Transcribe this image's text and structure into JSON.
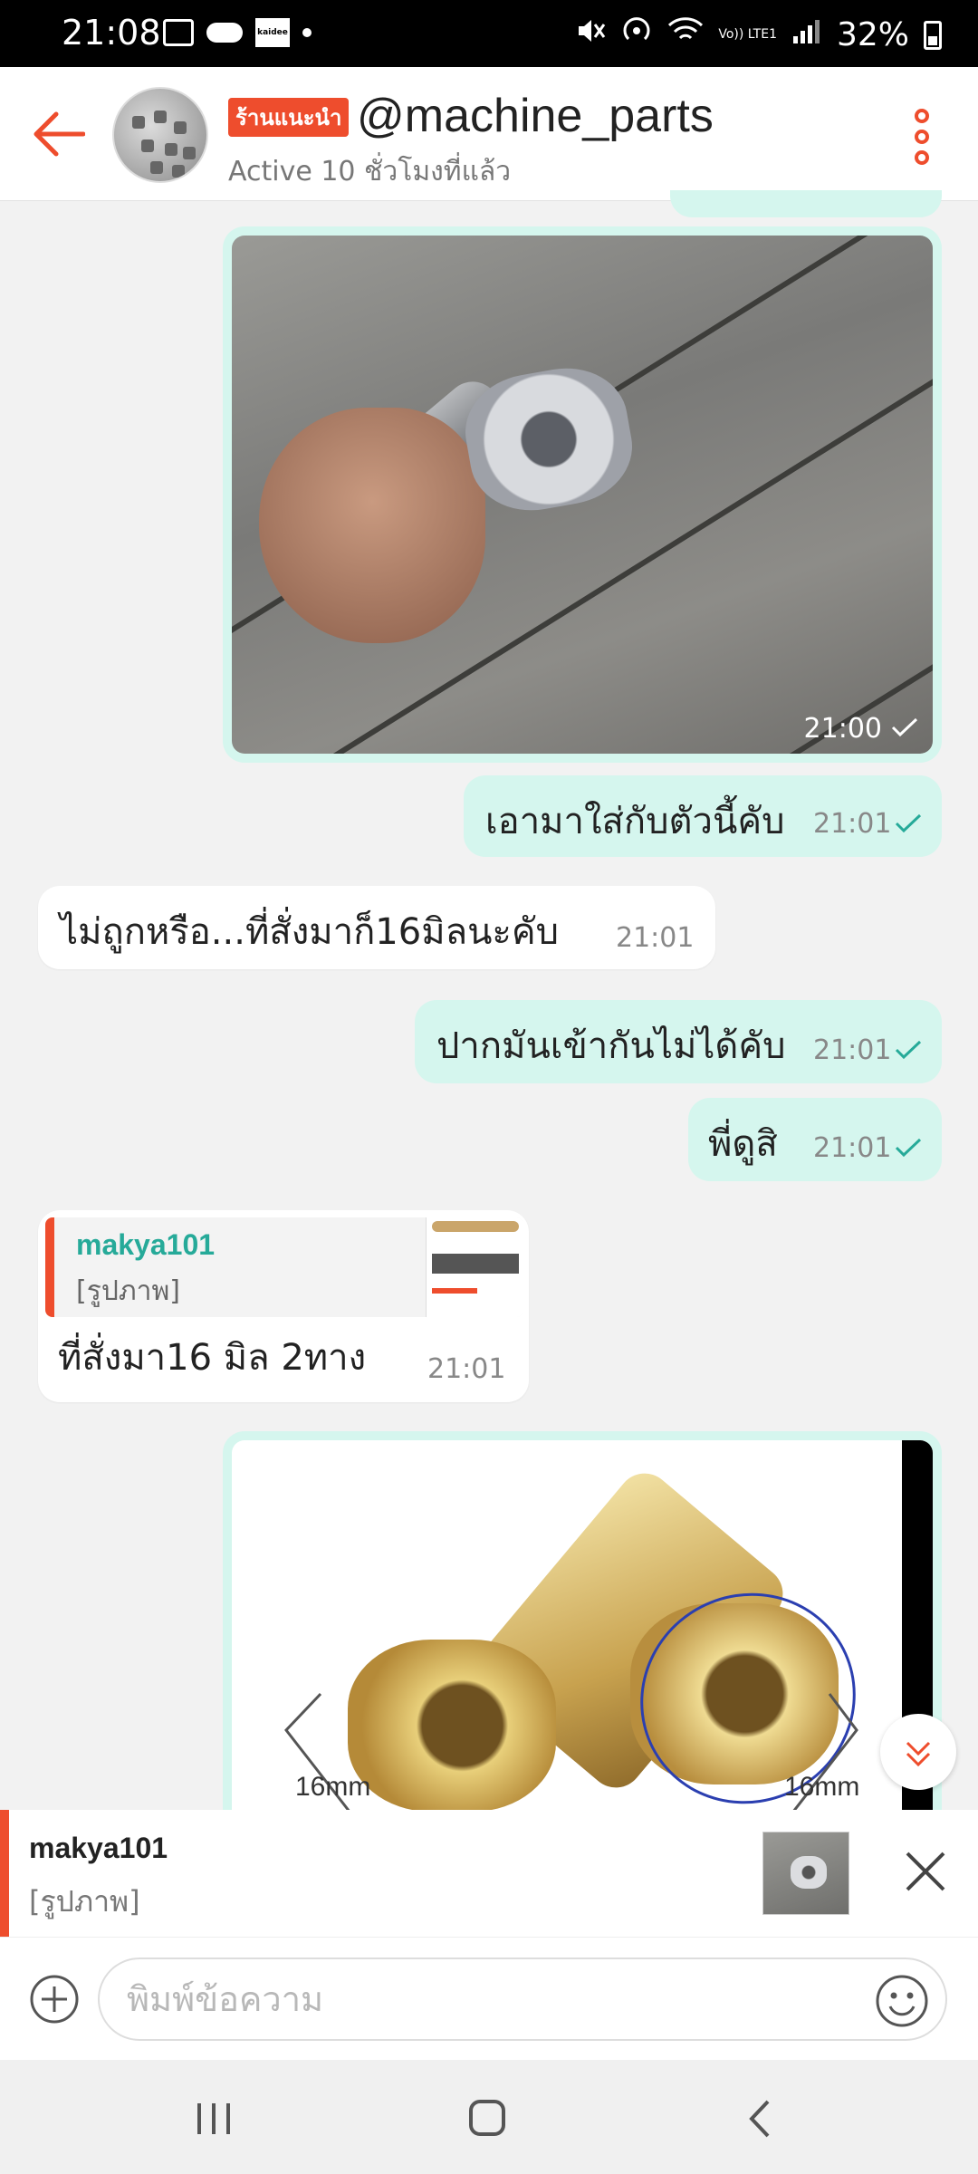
{
  "status_bar": {
    "time": "21:08",
    "kaidee": "kaidee",
    "network": "Vo)) LTE1",
    "battery": "32%"
  },
  "header": {
    "badge": "ร้านแนะนำ",
    "shop_name": "@machine_parts",
    "active": "Active 10 ชั่วโมงที่แล้ว"
  },
  "messages": [
    {
      "from": "me",
      "type": "image",
      "time": "21:00"
    },
    {
      "from": "me",
      "text": "เอามาใส่กับตัวนี้คับ",
      "time": "21:01"
    },
    {
      "from": "them",
      "text": "ไม่ถูกหรือ...ที่สั่งมาก็16มิลนะคับ",
      "time": "21:01"
    },
    {
      "from": "me",
      "text": "ปากมันเข้ากันไม่ได้คับ",
      "time": "21:01"
    },
    {
      "from": "me",
      "text": "พี่ดูสิ",
      "time": "21:01"
    },
    {
      "from": "them",
      "reply_to": {
        "name": "makya101",
        "preview": "[รูปภาพ]"
      },
      "text": "ที่สั่งมา16 มิล  2ทาง",
      "time": "21:01"
    },
    {
      "from": "me",
      "type": "image",
      "labels": [
        "16mm",
        "16mm"
      ]
    }
  ],
  "reply_preview": {
    "name": "makya101",
    "preview": "[รูปภาพ]"
  },
  "composer": {
    "placeholder": "พิมพ์ข้อความ"
  },
  "colors": {
    "brand": "#ee4d2d",
    "my_bubble": "#d5f6ee",
    "teal": "#26aa99"
  }
}
